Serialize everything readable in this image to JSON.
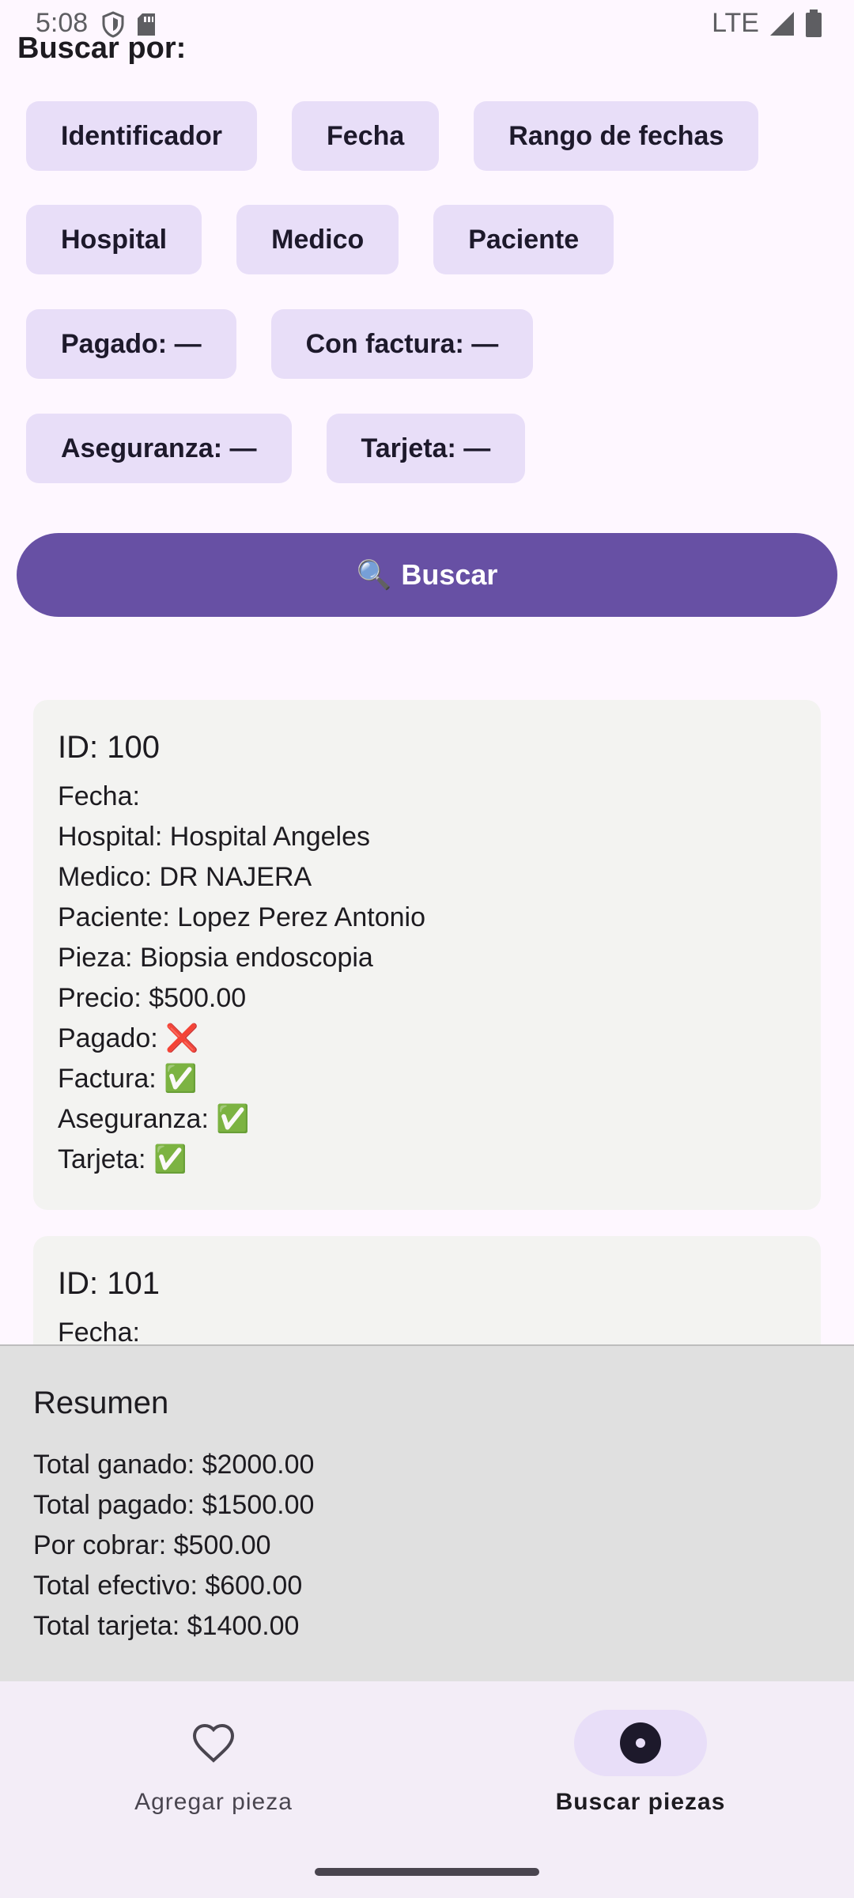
{
  "status": {
    "time": "5:08",
    "network": "LTE"
  },
  "filter": {
    "label": "Buscar por:",
    "chips_row1": [
      "Identificador",
      "Fecha",
      "Rango de fechas"
    ],
    "chips_row2": [
      "Hospital",
      "Medico",
      "Paciente"
    ],
    "chips_row3": [
      "Pagado: —",
      "Con factura: —"
    ],
    "chips_row4": [
      "Aseguranza: —",
      "Tarjeta: —"
    ]
  },
  "search_button": {
    "icon": "🔍",
    "label": "Buscar"
  },
  "results": [
    {
      "id": "ID: 100",
      "lines": [
        "Fecha:",
        "Hospital: Hospital Angeles",
        "Medico: DR NAJERA",
        "Paciente: Lopez Perez Antonio",
        "Pieza: Biopsia endoscopia",
        "Precio: $500.00",
        "Pagado: ❌",
        "Factura: ✅",
        "Aseguranza: ✅",
        "Tarjeta: ✅"
      ]
    },
    {
      "id": "ID: 101",
      "lines": [
        "Fecha:"
      ]
    }
  ],
  "summary": {
    "title": "Resumen",
    "lines": [
      "Total ganado: $2000.00",
      "Total pagado: $1500.00",
      "Por cobrar: $500.00",
      "Total efectivo: $600.00",
      "Total tarjeta: $1400.00"
    ]
  },
  "nav": {
    "items": [
      {
        "label": "Agregar pieza",
        "icon": "heart-icon",
        "active": false
      },
      {
        "label": "Buscar piezas",
        "icon": "record-icon",
        "active": true
      }
    ]
  },
  "colors": {
    "primary": "#6750A4",
    "chip": "#E8DEF8",
    "background": "#FEF7FF"
  }
}
